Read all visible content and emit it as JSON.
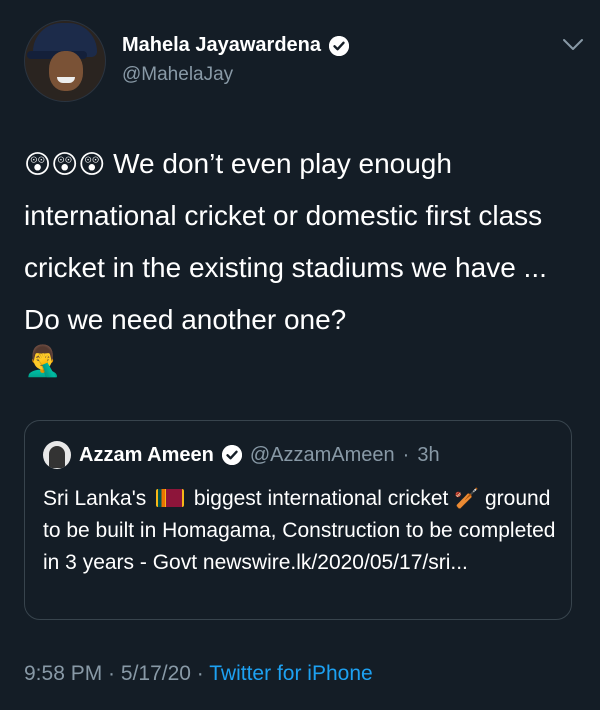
{
  "author": {
    "display_name": "Mahela Jayawardena",
    "handle": "@MahelaJay",
    "verified": true
  },
  "tweet": {
    "emojis_leading": "😲😲😲",
    "text": "We don’t even play enough international cricket or domestic first class cricket in the existing stadiums we have ... Do we need another one?",
    "emoji_trailing": "🤦‍♂️"
  },
  "quoted_tweet": {
    "display_name": "Azzam Ameen",
    "handle": "@AzzamAmeen",
    "separator": "·",
    "time": "3h",
    "text_part1": "Sri Lanka's",
    "text_part2": "biggest international cricket",
    "text_part3": "ground to be built in Homagama, Construction to be completed in 3 years - Govt",
    "link": "newswire.lk/2020/05/17/sri..."
  },
  "meta": {
    "time": "9:58 PM",
    "separator": " · ",
    "date": "5/17/20",
    "source": "Twitter for iPhone"
  },
  "colors": {
    "background": "#141d26",
    "muted": "#8899a6",
    "link": "#1da1f2",
    "border": "#38444d"
  }
}
